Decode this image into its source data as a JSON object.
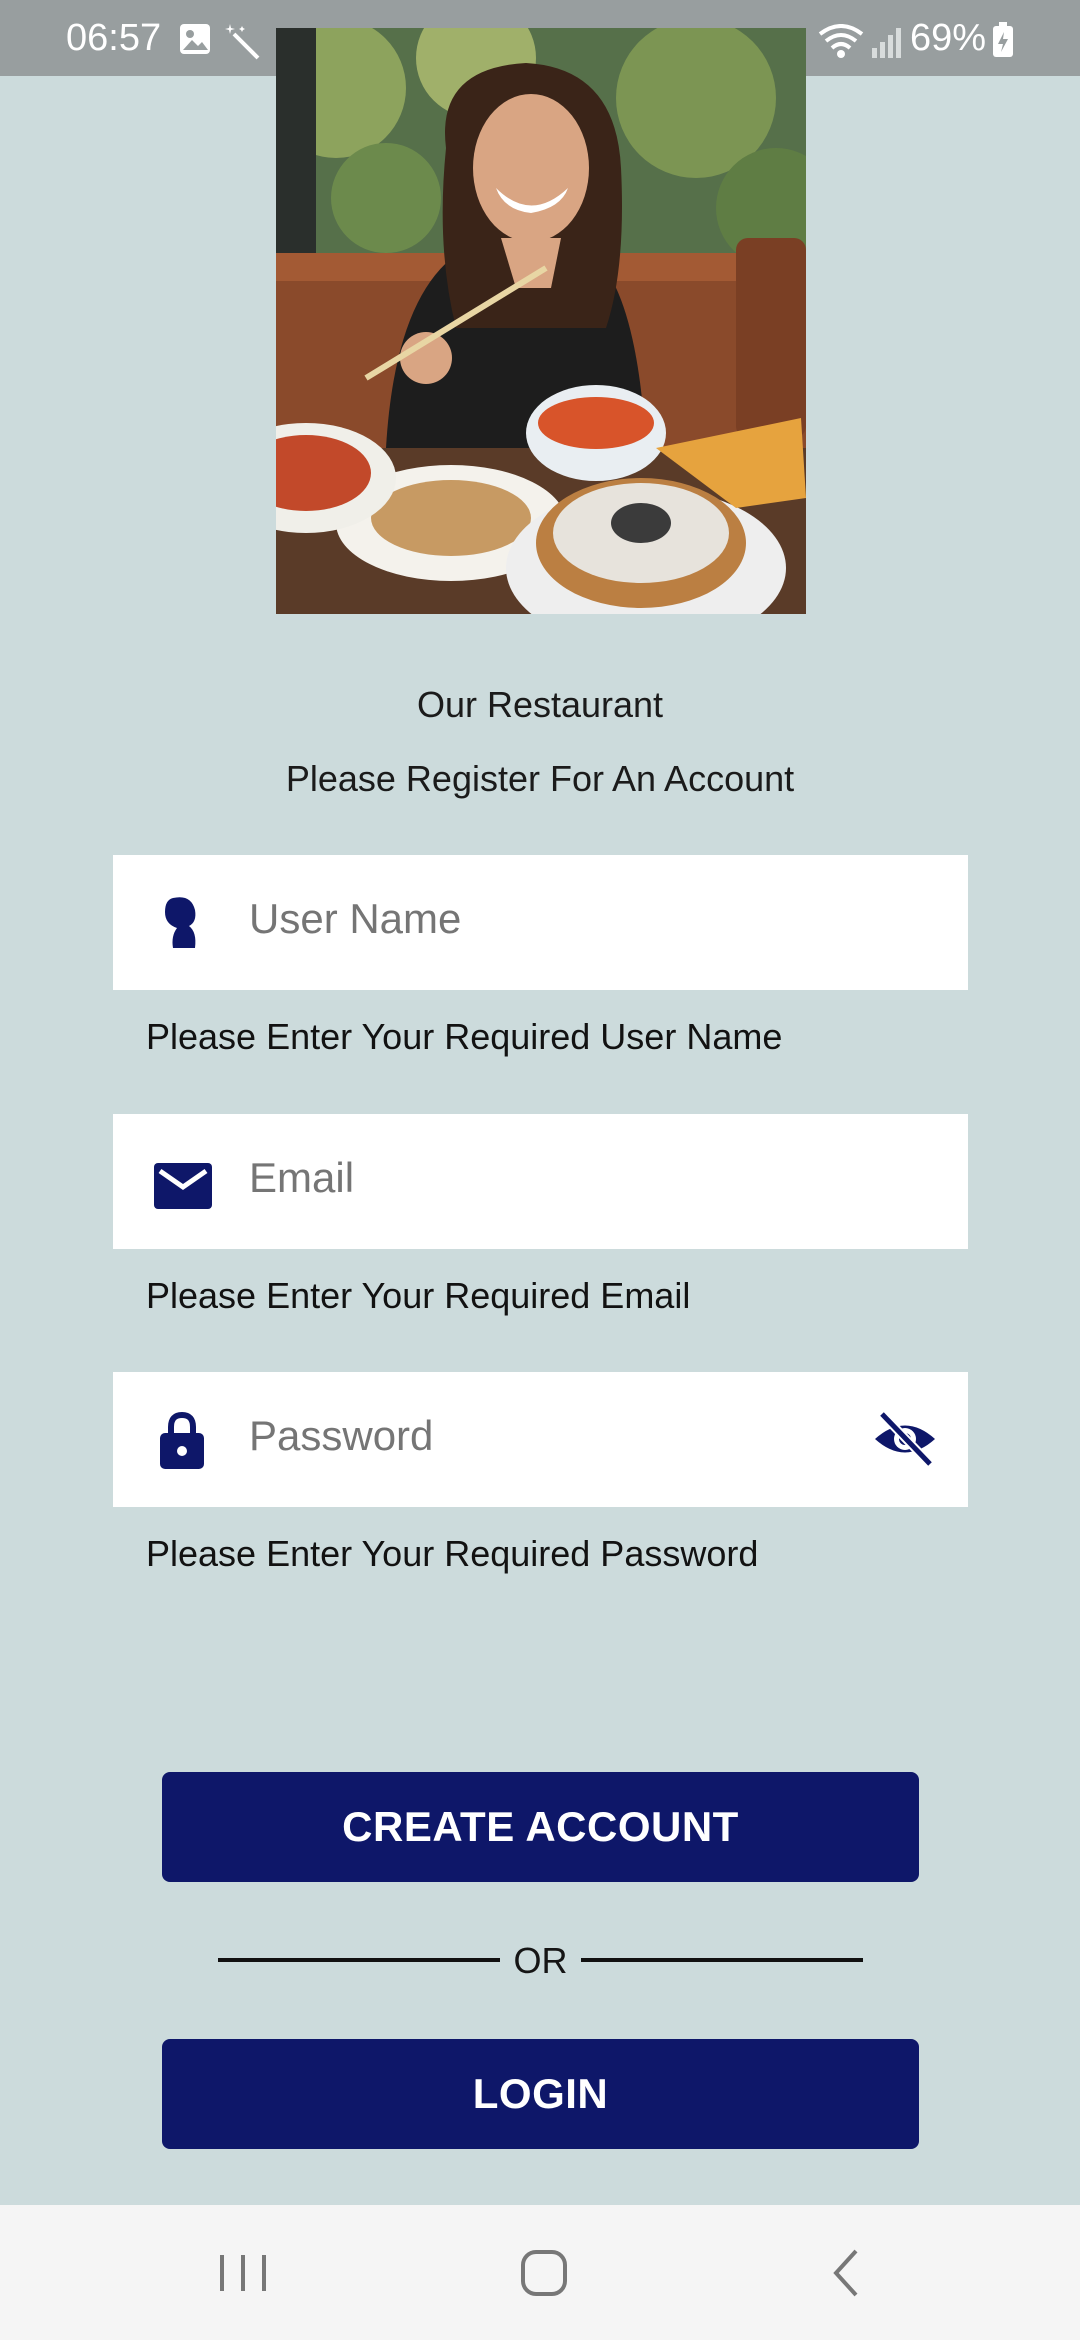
{
  "status_bar": {
    "time": "06:57",
    "battery": "69%"
  },
  "header": {
    "title": "Our Restaurant",
    "subtitle": "Please Register For An Account"
  },
  "form": {
    "username": {
      "placeholder": "User Name",
      "helper": "Please Enter Your Required User Name"
    },
    "email": {
      "placeholder": "Email",
      "helper": "Please Enter Your Required Email"
    },
    "password": {
      "placeholder": "Password",
      "helper": "Please Enter Your Required Password"
    }
  },
  "actions": {
    "create_label": "CREATE ACCOUNT",
    "or_label": "OR",
    "login_label": "LOGIN"
  },
  "colors": {
    "background": "#CCDBDC",
    "accent": "#0E1769",
    "field_bg": "#FFFFFF"
  }
}
